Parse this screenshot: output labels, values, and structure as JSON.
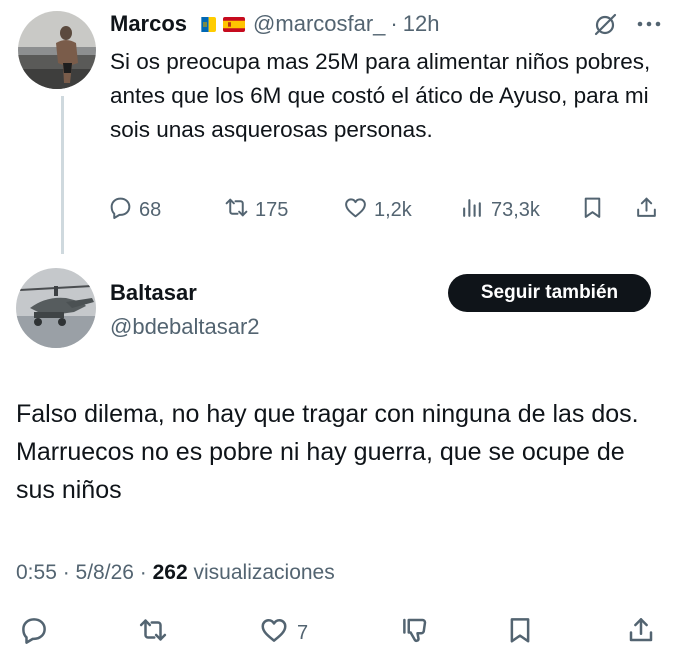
{
  "tweet1": {
    "author_name": "Marcos",
    "handle": "@marcosfar_",
    "separator": "·",
    "time": "12h",
    "text": "Si os preocupa mas 25M para alimentar niños pobres, antes que los 6M que costó el ático de Ayuso, para mi sois unas asquerosas personas.",
    "actions": {
      "replies": "68",
      "reposts": "175",
      "likes": "1,2k",
      "views": "73,3k"
    },
    "icons": [
      "grok-icon",
      "more-icon",
      "reply-icon",
      "repost-icon",
      "like-icon",
      "views-icon",
      "bookmark-icon",
      "share-icon"
    ]
  },
  "tweet2": {
    "author_name": "Baltasar",
    "handle": "@bdebaltasar2",
    "follow_label": "Seguir también",
    "text": "Falso dilema, no hay que tragar con ninguna de las dos. Marruecos no es pobre ni hay guerra, que se ocupe de sus niños",
    "time": "0:55",
    "date": "5/8/26",
    "views_count": "262",
    "views_label": "visualizaciones",
    "actions": {
      "likes": "7"
    },
    "icons": [
      "reply-icon",
      "repost-icon",
      "like-icon",
      "dislike-icon",
      "bookmark-icon",
      "share-icon"
    ]
  },
  "colors": {
    "text": "#0f1419",
    "secondary": "#536471",
    "thread_line": "#cfd9de",
    "button_bg": "#0f1419",
    "button_text": "#ffffff"
  }
}
